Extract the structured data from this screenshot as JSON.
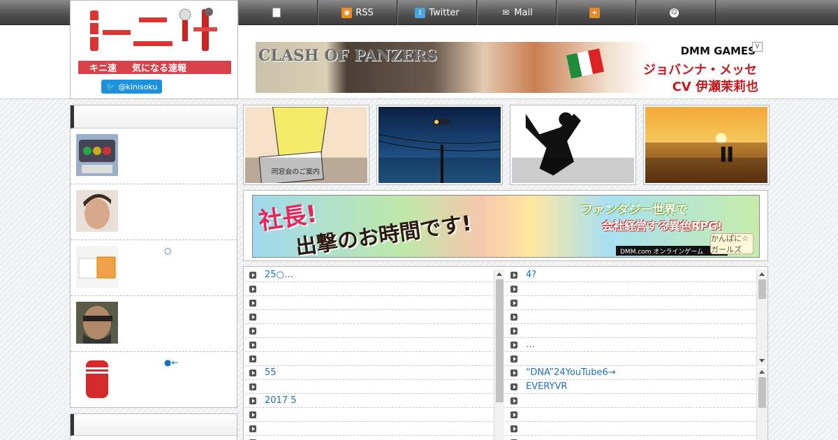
{
  "site": {
    "logo_title": "キニ速",
    "logo_tagline": "気になる速報",
    "twitter_handle": "@kinisoku"
  },
  "nav": [
    {
      "label": "",
      "icon": "document-icon"
    },
    {
      "label": "RSS",
      "icon": "rss-icon"
    },
    {
      "label": "Twitter",
      "icon": "twitter-icon"
    },
    {
      "label": "Mail",
      "icon": "mail-icon"
    },
    {
      "label": "",
      "icon": "calendar-icon"
    },
    {
      "label": "",
      "icon": "face-icon"
    }
  ],
  "top_banner": {
    "game": "CLASH OF PANZERS",
    "brand": "DMM GAMES",
    "character": "ジョバンナ・メッセ",
    "cv": "CV 伊瀬茉莉也",
    "ad_mark": "V"
  },
  "sidebar": {
    "items": [
      {
        "text": "",
        "thumb": "traffic-light"
      },
      {
        "text": "",
        "thumb": "man-face"
      },
      {
        "text": "○",
        "thumb": "box"
      },
      {
        "text": "",
        "thumb": "soldier"
      },
      {
        "text": "●←",
        "thumb": "tenga"
      }
    ]
  },
  "featured": [
    {
      "thumb": "invitation",
      "caption": "同窓会のご案内"
    },
    {
      "thumb": "power-lines",
      "caption": ""
    },
    {
      "thumb": "silhouette",
      "caption": ""
    },
    {
      "thumb": "sunset",
      "caption": ""
    }
  ],
  "mid_banner": {
    "line1": "社長!",
    "line2": "出撃のお時間です!",
    "right1": "ファンタジー世界で",
    "right2": "会社経営する異色RPG!",
    "footer": "DMM.com オンラインゲーム",
    "logo": "かんぱに☆ガールズ"
  },
  "news_left": [
    "25○…",
    "",
    "",
    "",
    "",
    "",
    "",
    "55",
    "",
    "2017 5",
    "",
    "",
    ""
  ],
  "news_right": [
    "4?",
    "",
    "",
    "",
    "",
    "…",
    "",
    "“DNA”24YouTube6→",
    " EVERYVR",
    "",
    "",
    "",
    ""
  ]
}
